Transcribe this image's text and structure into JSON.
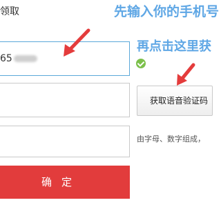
{
  "header": {
    "title": "领取"
  },
  "form": {
    "phone_value": "65",
    "voice_code_button": "获取语音验证码",
    "password_hint": "由字母、数字组成，",
    "submit_label": "确定"
  },
  "annotations": {
    "step1": "先输入你的手机号",
    "step2": "再点击这里获"
  },
  "colors": {
    "annotation": "#5fa7e5",
    "arrow": "#e43c3c",
    "submit": "#e23c3c",
    "success": "#7cc04b"
  },
  "icons": {
    "phone_status": "check-circle-icon",
    "annotation_arrows": "arrow-icon"
  }
}
